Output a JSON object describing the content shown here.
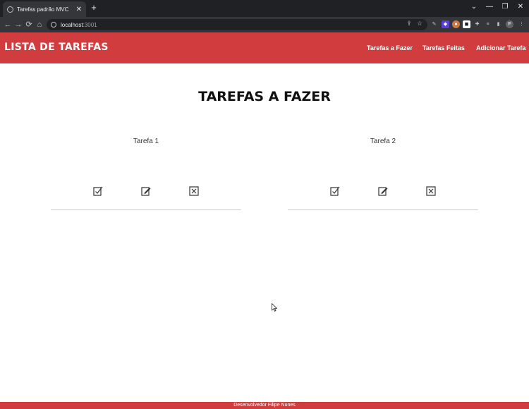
{
  "browser": {
    "tab_title": "Tarefas padrão MVC",
    "tab_close": "✕",
    "new_tab": "+",
    "url_host": "localhost",
    "url_port": ":3001",
    "profile_initial": "F",
    "window_controls": [
      "⌄",
      "—",
      "❐",
      "✕"
    ]
  },
  "app": {
    "brand": "LISTA DE TAREFAS",
    "nav": [
      "Tarefas a Fazer",
      "Tarefas Feitas",
      "Adicionar Tarefa"
    ],
    "page_title": "TAREFAS A FAZER",
    "tasks": [
      {
        "name": "Tarefa 1"
      },
      {
        "name": "Tarefa 2"
      }
    ],
    "footer": "Desenvolvedor Filipe Nunes"
  },
  "colors": {
    "accent": "#d13d3f",
    "chrome_dark": "#202124",
    "chrome_toolbar": "#35363a"
  }
}
